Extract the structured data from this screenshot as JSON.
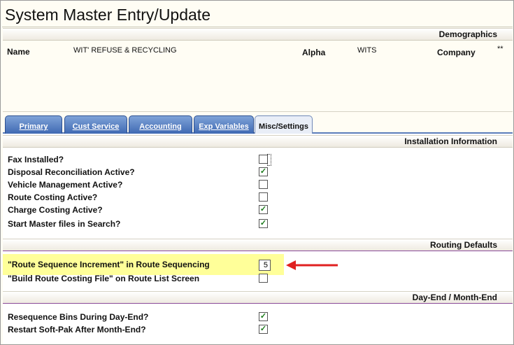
{
  "page": {
    "title": "System Master Entry/Update"
  },
  "demographics": {
    "header": "Demographics",
    "name_label": "Name",
    "name_value": "WIT' REFUSE & RECYCLING",
    "alpha_label": "Alpha",
    "alpha_value": "WITS",
    "company_label": "Company",
    "company_value": "**"
  },
  "tabs": [
    {
      "label": "Primary",
      "active": false
    },
    {
      "label": "Cust Service",
      "active": false
    },
    {
      "label": "Accounting",
      "active": false
    },
    {
      "label": "Exp Variables",
      "active": false
    },
    {
      "label": "Misc/Settings",
      "active": true
    }
  ],
  "installation": {
    "header": "Installation Information",
    "items": [
      {
        "label": "Fax Installed?",
        "checked": false
      },
      {
        "label": "Disposal Reconciliation Active?",
        "checked": true
      },
      {
        "label": "Vehicle Management Active?",
        "checked": false
      },
      {
        "label": "Route Costing Active?",
        "checked": false
      },
      {
        "label": "Charge Costing Active?",
        "checked": true
      },
      {
        "label": "Start Master files in Search?",
        "checked": true
      }
    ]
  },
  "routing": {
    "header": "Routing Defaults",
    "increment_label": "\"Route Sequence Increment\" in Route Sequencing",
    "increment_value": "5",
    "build_label": "\"Build Route Costing File\" on Route List Screen",
    "build_checked": false
  },
  "dayend": {
    "header": "Day-End / Month-End",
    "items": [
      {
        "label": "Resequence Bins During Day-End?",
        "checked": true
      },
      {
        "label": "Restart Soft-Pak After Month-End?",
        "checked": true
      }
    ]
  },
  "colors": {
    "arrow": "#e02020",
    "highlight": "#ffff99",
    "tab": "#4a72b8"
  }
}
